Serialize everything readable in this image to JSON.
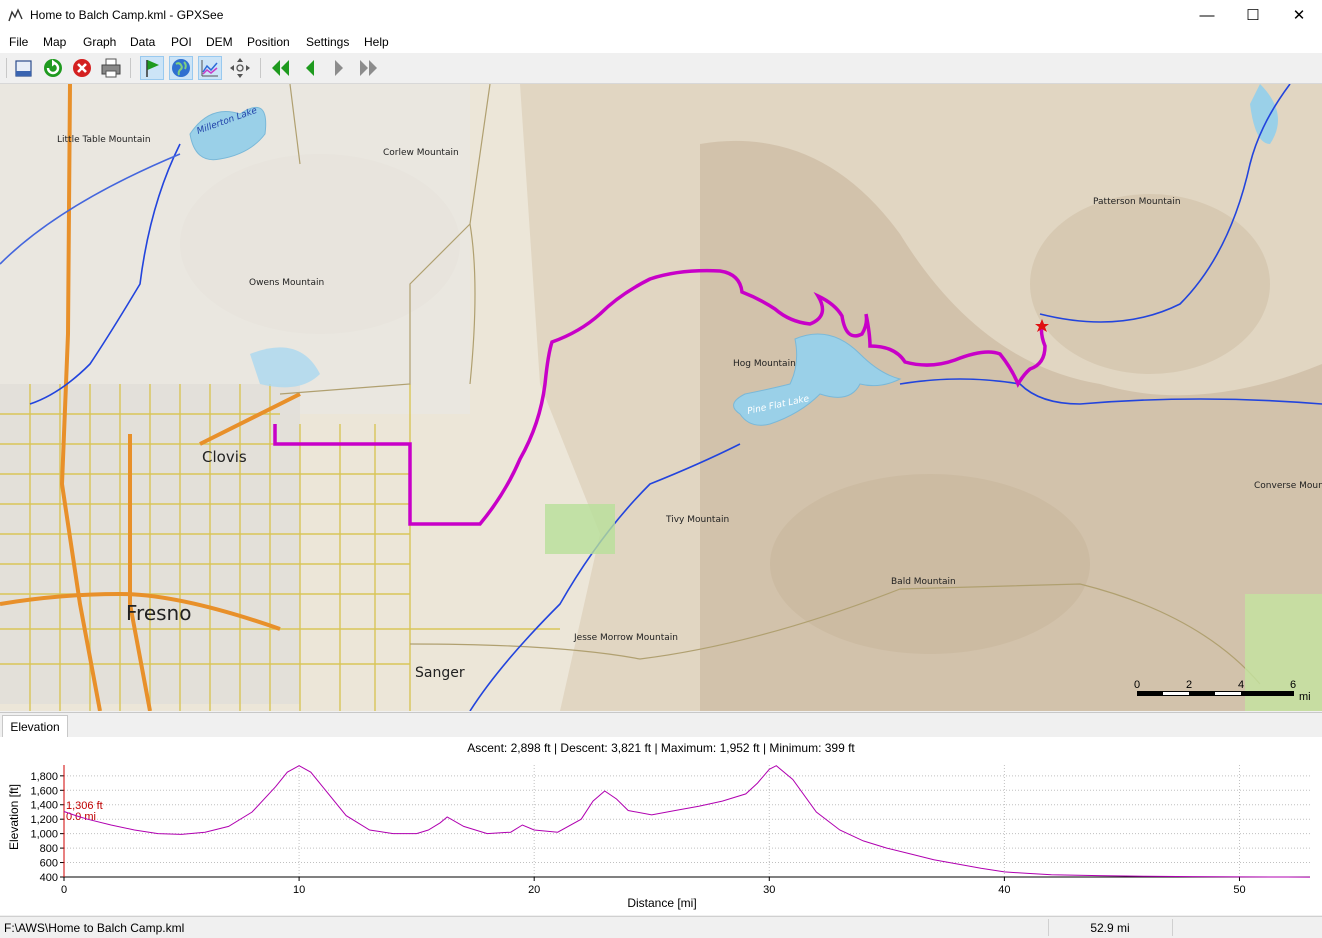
{
  "window": {
    "title": "Home to Balch Camp.kml - GPXSee",
    "minimize": "—",
    "maximize": "☐",
    "close": "✕"
  },
  "menu": [
    "File",
    "Map",
    "Graph",
    "Data",
    "POI",
    "DEM",
    "Position",
    "Settings",
    "Help"
  ],
  "toolbar": {
    "buttons": [
      "open-file-icon",
      "reload-icon",
      "close-file-icon",
      "print-icon",
      "show-waypoints-icon",
      "show-map-icon",
      "show-graphs-icon",
      "fullscreen-icon",
      "first-file-icon",
      "previous-file-icon",
      "next-file-icon",
      "last-file-icon"
    ]
  },
  "map": {
    "places": {
      "little_table": "Little Table Mountain",
      "millerton": "Millerton Lake",
      "corlew": "Corlew Mountain",
      "owens": "Owens Mountain",
      "clovis": "Clovis",
      "fresno": "Fresno",
      "sanger": "Sanger",
      "hog": "Hog Mountain",
      "pine_flat": "Pine Flat Lake",
      "tivy": "Tivy Mountain",
      "jesse": "Jesse Morrow Mountain",
      "bald": "Bald Mountain",
      "patterson": "Patterson Mountain",
      "converse": "Converse Moun"
    },
    "scale": {
      "labels": [
        "0",
        "2",
        "4",
        "6"
      ],
      "unit": "mi"
    },
    "route_color": "#c800c8",
    "river_color": "#2244dd"
  },
  "graph": {
    "tab_label": "Elevation",
    "summary": "Ascent: 2,898 ft | Descent: 3,821 ft | Maximum: 1,952 ft | Minimum: 399 ft",
    "marker_elevation": "1,306 ft",
    "marker_distance": "0.0 mi",
    "ylabel": "Elevation [ft]",
    "xlabel": "Distance [mi]",
    "line_color": "#b000b0"
  },
  "chart_data": {
    "type": "line",
    "xlabel": "Distance [mi]",
    "ylabel": "Elevation [ft]",
    "xlim": [
      0,
      53
    ],
    "ylim": [
      400,
      1950
    ],
    "xticks": [
      0,
      10,
      20,
      30,
      40,
      50
    ],
    "yticks": [
      400,
      600,
      800,
      1000,
      1200,
      1400,
      1600,
      1800
    ],
    "series": [
      {
        "x": [
          0,
          0.5,
          1,
          2,
          3,
          4,
          5,
          6,
          7,
          8,
          9,
          9.5,
          10,
          10.5,
          11,
          12,
          13,
          14,
          15,
          15.5,
          16,
          16.3,
          17,
          18,
          19,
          19.5,
          20,
          21,
          22,
          22.5,
          23,
          23.5,
          24,
          25,
          26,
          27,
          28,
          29,
          29.5,
          30,
          30.3,
          31,
          32,
          33,
          34,
          35,
          36,
          37,
          38,
          39,
          40,
          41,
          42,
          44,
          46,
          48,
          50,
          52,
          53
        ],
        "y": [
          1306,
          1250,
          1200,
          1120,
          1050,
          1000,
          990,
          1020,
          1100,
          1300,
          1650,
          1850,
          1940,
          1850,
          1650,
          1250,
          1050,
          1000,
          1000,
          1050,
          1150,
          1230,
          1100,
          1000,
          1020,
          1120,
          1050,
          1020,
          1200,
          1450,
          1590,
          1480,
          1320,
          1260,
          1320,
          1380,
          1450,
          1550,
          1700,
          1890,
          1940,
          1750,
          1300,
          1050,
          900,
          800,
          720,
          640,
          580,
          520,
          470,
          450,
          430,
          420,
          410,
          405,
          402,
          400,
          399
        ]
      }
    ]
  },
  "status": {
    "file_path": "F:\\AWS\\Home to Balch Camp.kml",
    "distance": "52.9 mi"
  }
}
